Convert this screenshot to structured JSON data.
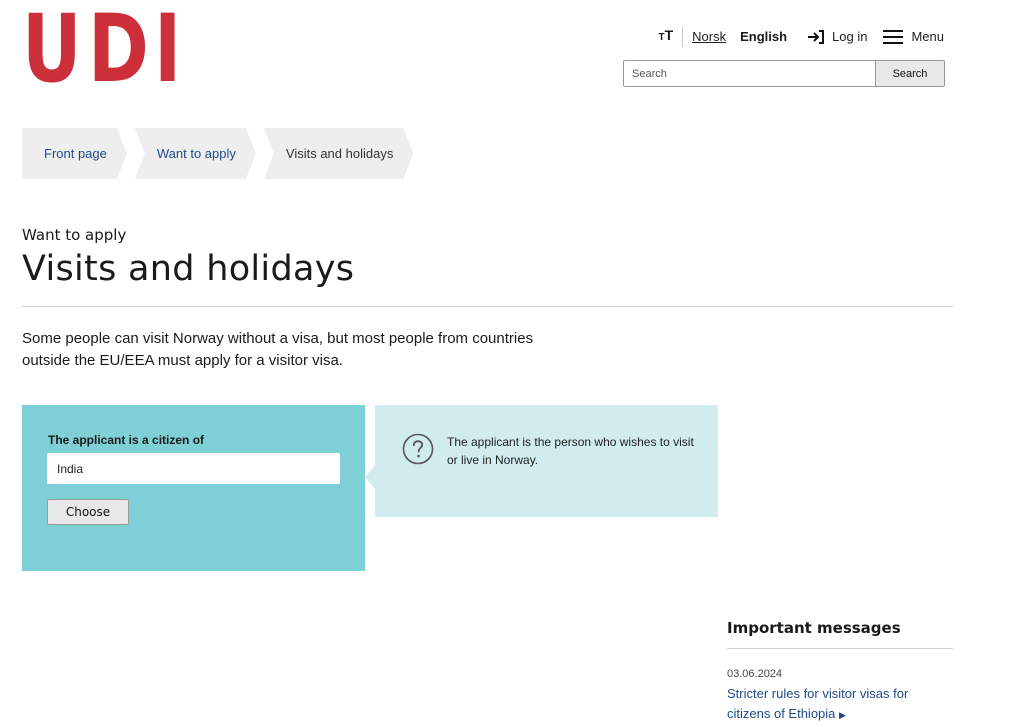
{
  "logo": {
    "letters": [
      "U",
      "D",
      "I"
    ],
    "brand_color": "#cc2e3a"
  },
  "header": {
    "text_size_label": "T",
    "text_size_prefix": "T",
    "lang_norsk": "Norsk",
    "lang_english": "English",
    "login": "Log in",
    "menu": "Menu",
    "login_icon": "login-arrow-icon",
    "menu_icon": "hamburger-icon"
  },
  "search": {
    "placeholder": "Search",
    "button": "Search"
  },
  "breadcrumb": {
    "items": [
      {
        "label": "Front page"
      },
      {
        "label": "Want to apply"
      },
      {
        "label": "Visits and holidays"
      }
    ]
  },
  "page": {
    "supertitle": "Want to apply",
    "title": "Visits and holidays",
    "intro": "Some people can visit Norway without a visa, but most people from countries outside the EU/EEA must apply for a visitor visa."
  },
  "citizen_form": {
    "label": "The applicant is a citizen of",
    "value": "India",
    "button": "Choose",
    "bg_color": "#7fcfd6"
  },
  "info": {
    "icon": "question-circle-icon",
    "text": "The applicant is the person who wishes to visit or live in Norway.",
    "bg_color": "#d0ecef"
  },
  "messages": {
    "title": "Important messages",
    "items": [
      {
        "date": "03.06.2024",
        "text": "Stricter rules for visitor visas for citizens of Ethiopia"
      }
    ]
  }
}
